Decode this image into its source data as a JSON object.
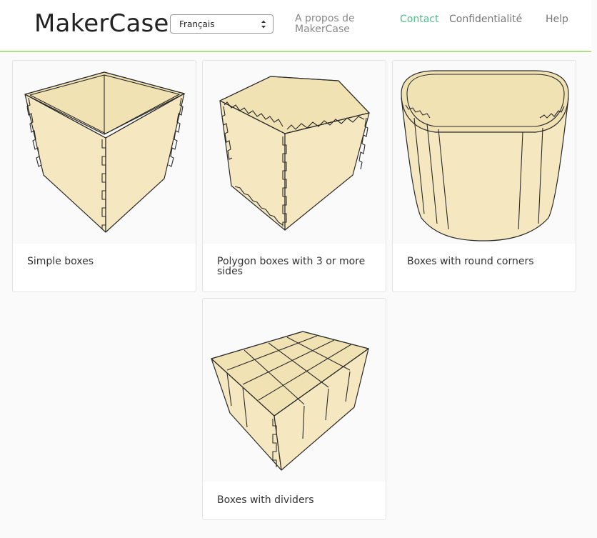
{
  "header": {
    "brand": "MakerCase",
    "language": "Français",
    "nav": {
      "about": "A propos de MakerCase",
      "contact": "Contact",
      "privacy": "Confidentialité",
      "help": "Help"
    },
    "colors": {
      "accent": "#4fbf8a",
      "divider": "#b7d98b"
    }
  },
  "cards": [
    {
      "caption": "Simple boxes"
    },
    {
      "caption": "Polygon boxes with 3 or more sides"
    },
    {
      "caption": "Boxes with round corners"
    },
    {
      "caption": "Boxes with dividers"
    }
  ]
}
